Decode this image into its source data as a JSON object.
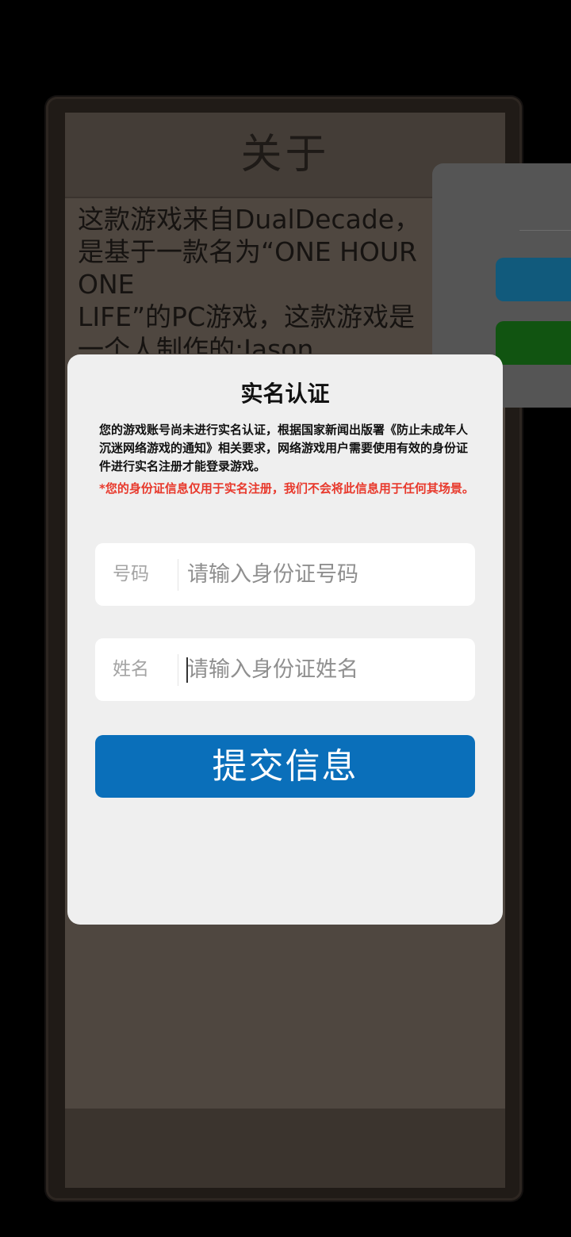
{
  "about": {
    "title": "关于",
    "lines": [
      "这款游戏来自DualDecade，",
      "是基于一款名为“ONE HOUR",
      "ONE",
      "LIFE”的PC游戏，这款游戏是",
      "一个人制作的:Jason"
    ]
  },
  "dialog": {
    "title": "实名认证",
    "description": "您的游戏账号尚未进行实名认证，根据国家新闻出版署《防止未成年人沉迷网络游戏的通知》相关要求，网络游戏用户需要使用有效的身份证件进行实名注册才能登录游戏。",
    "warning": "*您的身份证信息仅用于实名注册，我们不会将此信息用于任何其场景。",
    "id_field": {
      "label": "号码",
      "placeholder": "请输入身份证号码",
      "value": ""
    },
    "name_field": {
      "label": "姓名",
      "placeholder": "请输入身份证姓名",
      "value": ""
    },
    "submit_label": "提交信息"
  },
  "colors": {
    "submit_button": "#0a6fba",
    "warning_text": "#e8392c",
    "dialog_bg": "#efefef"
  }
}
